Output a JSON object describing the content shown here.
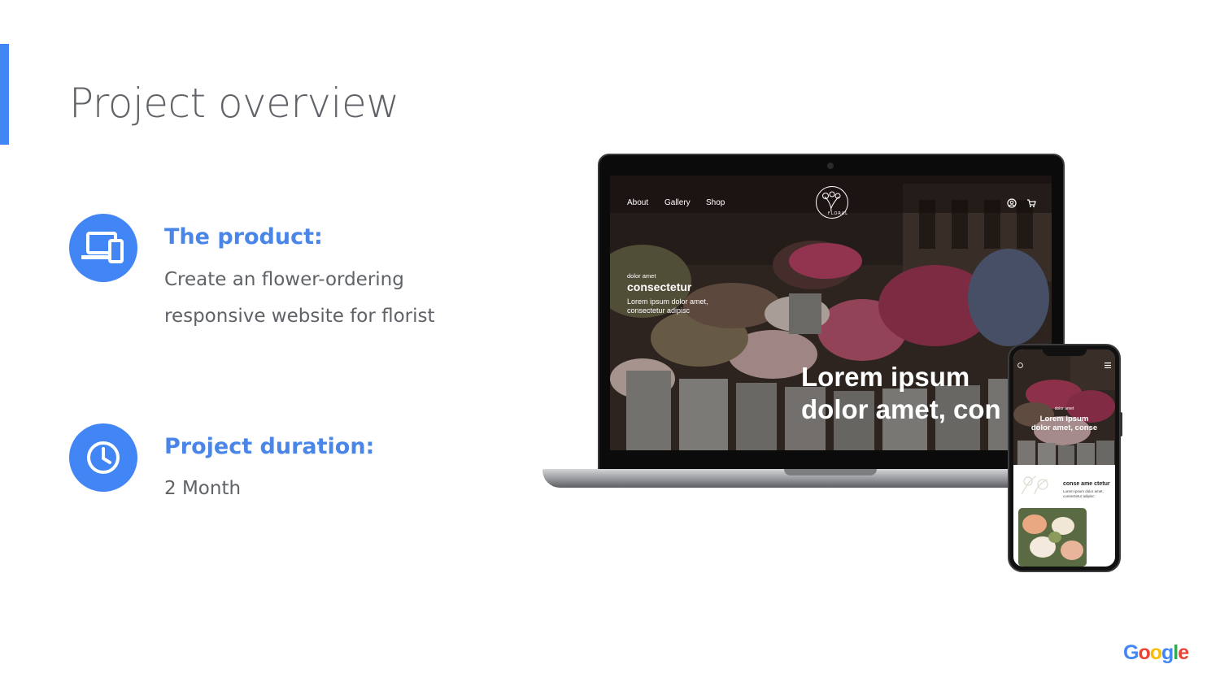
{
  "slide": {
    "title": "Project overview"
  },
  "product": {
    "heading": "The product:",
    "description_line1": "Create an flower-ordering",
    "description_line2": "responsive website for florist",
    "icon": "devices-icon"
  },
  "duration": {
    "heading": "Project duration:",
    "value": "2 Month",
    "icon": "clock-icon"
  },
  "laptop_site": {
    "nav": [
      "About",
      "Gallery",
      "Shop"
    ],
    "logo_text": "FLORAL",
    "icons": [
      "account-icon",
      "cart-icon"
    ],
    "hero_kicker": "dolor amet",
    "hero_title": "consectetur",
    "hero_body_1": "Lorem ipsum dolor amet,",
    "hero_body_2": "consectetur adipisc",
    "hero_big_1": "Lorem ipsum",
    "hero_big_2": "dolor amet, con"
  },
  "phone_site": {
    "kicker": "dolor amet",
    "big_1": "Lorem ipsum",
    "big_2": "dolor amet, conse",
    "section_title": "conse ame ctetur",
    "section_body_1": "Lorem ipsum dolor amet,",
    "section_body_2": "consectetur adipisc",
    "icons": [
      "account-icon",
      "menu-icon"
    ]
  },
  "brand": {
    "logo": "Google",
    "colors": [
      "#4285f4",
      "#ea4335",
      "#fbbc05",
      "#4285f4",
      "#34a853",
      "#ea4335"
    ]
  },
  "colors": {
    "accent": "#4285f4",
    "heading": "#4a86e8",
    "text": "#5f6368"
  }
}
